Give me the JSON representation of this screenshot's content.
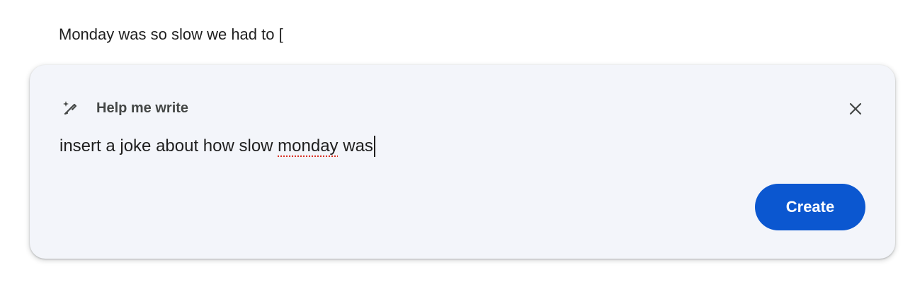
{
  "document": {
    "text": "Monday was so slow we had to ["
  },
  "help_panel": {
    "title": "Help me write",
    "icon": "pen-sparkle-icon",
    "close_icon": "close-icon",
    "prompt": {
      "before": "insert a joke about how slow ",
      "misspelled_word": "monday",
      "after": " was"
    },
    "create_label": "Create",
    "colors": {
      "panel_background": "#f3f5fa",
      "accent": "#0b57d0",
      "spellcheck_underline": "#d93025"
    }
  }
}
